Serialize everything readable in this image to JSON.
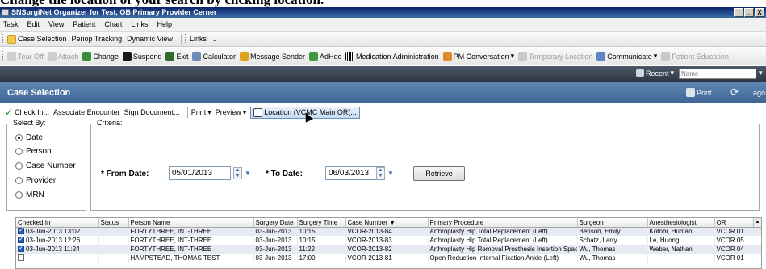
{
  "caption": "Change the location of your search by clicking location.",
  "window": {
    "title": "SNSurgiNet Organizer for Test, OB Primary Provider Cerner",
    "controls": [
      "_",
      "□",
      "X"
    ]
  },
  "menu": [
    "Task",
    "Edit",
    "View",
    "Patient",
    "Chart",
    "Links",
    "Help"
  ],
  "toolbar1": {
    "items": [
      "Case Selection",
      "Periop Tracking",
      "Dynamic View"
    ],
    "links": "Links"
  },
  "toolbar2": {
    "items": [
      {
        "label": "Tear Off",
        "icon": "tear-off-icon",
        "disabled": true
      },
      {
        "label": "Attach",
        "icon": "attach-icon",
        "disabled": true
      },
      {
        "label": "Change",
        "icon": "change-icon",
        "disabled": false
      },
      {
        "label": "Suspend",
        "icon": "suspend-icon",
        "disabled": false
      },
      {
        "label": "Exit",
        "icon": "exit-icon",
        "disabled": false
      },
      {
        "label": "Calculator",
        "icon": "calculator-icon",
        "disabled": false
      },
      {
        "label": "Message Sender",
        "icon": "message-sender-icon",
        "disabled": false
      },
      {
        "label": "AdHoc",
        "icon": "adhoc-icon",
        "disabled": false
      },
      {
        "label": "Medication Administration",
        "icon": "barcode-icon",
        "disabled": false
      },
      {
        "label": "PM Conversation",
        "icon": "pm-conversation-icon",
        "disabled": false
      },
      {
        "label": "Temporary Location",
        "icon": "temporary-location-icon",
        "disabled": true
      },
      {
        "label": "Communicate",
        "icon": "communicate-icon",
        "disabled": false
      },
      {
        "label": "Patient Education",
        "icon": "patient-education-icon",
        "disabled": true
      }
    ]
  },
  "searchbar": {
    "recent_label": "Recent",
    "name_placeholder": "Name"
  },
  "header": {
    "title": "Case Selection",
    "print_label": "Print",
    "ago": "ago"
  },
  "actions": {
    "check_in": "Check In...",
    "associate": "Associate Encounter",
    "sign": "Sign Document...",
    "print": "Print",
    "preview": "Preview",
    "location": "Location (VCMC Main OR)..."
  },
  "select_by": {
    "legend": "Select By:",
    "options": [
      "Date",
      "Person",
      "Case Number",
      "Provider",
      "MRN"
    ],
    "selected": "Date"
  },
  "criteria": {
    "legend": "Criteria:",
    "from_label": "* From Date:",
    "from_value": "05/01/2013",
    "to_label": "* To Date:",
    "to_value": "06/03/2013",
    "retrieve": "Retrieve"
  },
  "grid": {
    "columns": [
      "Checked In",
      "Status",
      "Person Name",
      "Surgery Date",
      "Surgery Time",
      "Case Number ▼",
      "Primary Procedure",
      "Surgeon",
      "Anesthesiologist",
      "OR"
    ],
    "rows": [
      {
        "checked": true,
        "checked_in": "03-Jun-2013 13:02",
        "status": "",
        "person": "FORTYTHREE, INT-THREE",
        "date": "03-Jun-2013",
        "time": "10:15",
        "case": "VCOR-2013-84",
        "procedure": "Arthroplasty Hip Total Replacement (Left)",
        "surgeon": "Benson, Emily",
        "anesth": "Kotobi, Human",
        "or": "VCOR 01"
      },
      {
        "checked": true,
        "checked_in": "03-Jun-2013 12:26",
        "status": "",
        "person": "FORTYTHREE, INT-THREE",
        "date": "03-Jun-2013",
        "time": "10:15",
        "case": "VCOR-2013-83",
        "procedure": "Arthroplasty Hip Total Replacement (Left)",
        "surgeon": "Schatz, Larry",
        "anesth": "Le, Huong",
        "or": "VCOR 05"
      },
      {
        "checked": true,
        "checked_in": "03-Jun-2013 11:24",
        "status": "",
        "person": "FORTYTHREE, INT-THREE",
        "date": "03-Jun-2013",
        "time": "11:22",
        "case": "VCOR-2013-82",
        "procedure": "Arthroplasty Hip Removal Prosthesis Insertion Spacer (Left)",
        "surgeon": "Wu, Thomas",
        "anesth": "Weber, Nathan",
        "or": "VCOR 04"
      },
      {
        "checked": false,
        "checked_in": "",
        "status": "",
        "person": "HAMPSTEAD, THOMAS TEST",
        "date": "03-Jun-2013",
        "time": "17:00",
        "case": "VCOR-2013-81",
        "procedure": "Open Reduction Internal Fixation Ankle (Left)",
        "surgeon": "Wu, Thomas",
        "anesth": "",
        "or": "VCOR 01"
      }
    ]
  }
}
